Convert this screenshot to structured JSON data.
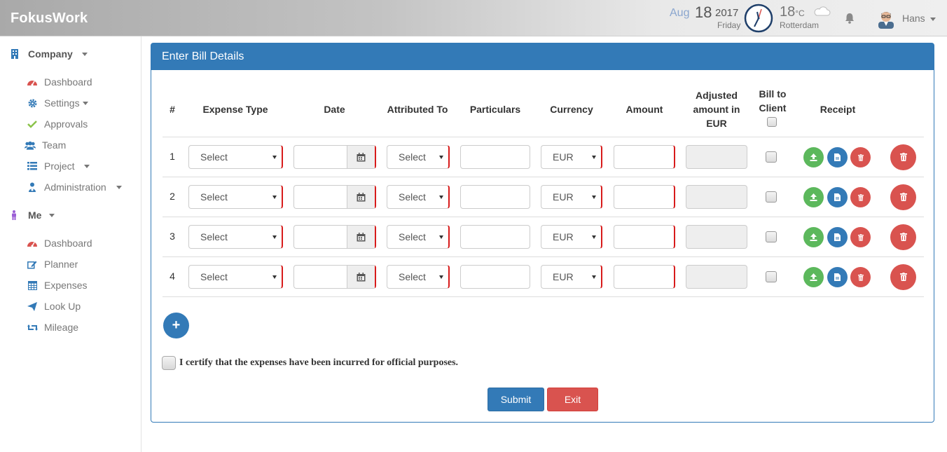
{
  "app": {
    "title": "FokusWork"
  },
  "header": {
    "date_month": "Aug",
    "date_day": "18",
    "date_year": "2017",
    "weekday": "Friday",
    "temperature": "18",
    "temperature_unit": "°C",
    "city": "Rotterdam",
    "user_name": "Hans"
  },
  "sidebar": {
    "company": {
      "label": "Company",
      "items": [
        {
          "label": "Dashboard",
          "icon": "dashboard-icon",
          "color": "#d9534f"
        },
        {
          "label": "Settings",
          "icon": "gear-icon",
          "color": "#337ab7"
        },
        {
          "label": "Approvals",
          "icon": "check-icon",
          "color": "#8bc34a"
        },
        {
          "label": "Team",
          "icon": "users-icon",
          "color": "#337ab7"
        },
        {
          "label": "Project",
          "icon": "list-icon",
          "color": "#337ab7"
        },
        {
          "label": "Administration",
          "icon": "admin-icon",
          "color": "#337ab7"
        }
      ]
    },
    "me": {
      "label": "Me",
      "items": [
        {
          "label": "Dashboard",
          "icon": "dashboard-icon",
          "color": "#d9534f"
        },
        {
          "label": "Planner",
          "icon": "edit-icon",
          "color": "#337ab7"
        },
        {
          "label": "Expenses",
          "icon": "calculator-icon",
          "color": "#337ab7"
        },
        {
          "label": "Look Up",
          "icon": "send-icon",
          "color": "#337ab7"
        },
        {
          "label": "Mileage",
          "icon": "retweet-icon",
          "color": "#337ab7"
        }
      ]
    }
  },
  "panel": {
    "title": "Enter Bill Details",
    "columns": {
      "num": "#",
      "expense_type": "Expense Type",
      "date": "Date",
      "attributed_to": "Attributed To",
      "particulars": "Particulars",
      "currency": "Currency",
      "amount": "Amount",
      "adjusted_1": "Adjusted",
      "adjusted_2": "amount in",
      "adjusted_3": "EUR",
      "bill_1": "Bill to",
      "bill_2": "Client",
      "receipt": "Receipt"
    },
    "rows": [
      {
        "num": "1",
        "expense_type": "Select",
        "attributed_to": "Select",
        "currency": "EUR"
      },
      {
        "num": "2",
        "expense_type": "Select",
        "attributed_to": "Select",
        "currency": "EUR"
      },
      {
        "num": "3",
        "expense_type": "Select",
        "attributed_to": "Select",
        "currency": "EUR"
      },
      {
        "num": "4",
        "expense_type": "Select",
        "attributed_to": "Select",
        "currency": "EUR"
      }
    ],
    "add_label": "+",
    "certify_text": "I certify that the expenses have been incurred for official purposes.",
    "submit_label": "Submit",
    "exit_label": "Exit"
  },
  "colors": {
    "primary": "#337ab7",
    "danger": "#d9534f",
    "success": "#5cb85c",
    "required": "#d81b1b"
  }
}
